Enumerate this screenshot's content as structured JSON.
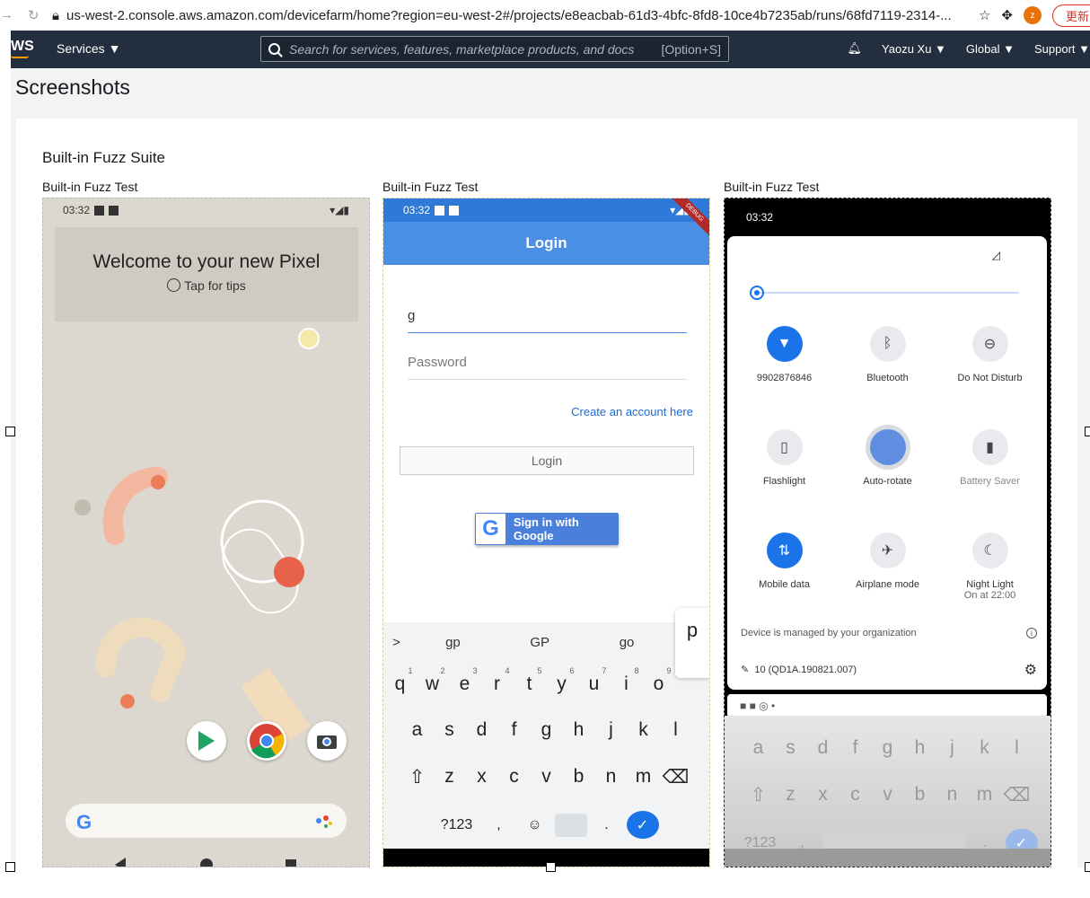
{
  "browser": {
    "url": "us-west-2.console.aws.amazon.com/devicefarm/home?region=eu-west-2#/projects/e8eacbab-61d3-4bfc-8fd8-10ce4b7235ab/runs/68fd7119-2314-...",
    "profile": "z",
    "update": "更新"
  },
  "aws": {
    "logo": "WS",
    "services": "Services ▼",
    "search_placeholder": "Search for services, features, marketplace products, and docs",
    "search_hint": "[Option+S]",
    "user": "Yaozu Xu ▼",
    "region": "Global ▼",
    "support": "Support ▼"
  },
  "page": {
    "title": "Screenshots",
    "suite": "Built-in Fuzz Suite"
  },
  "shots": [
    {
      "label": "Built-in Fuzz Test"
    },
    {
      "label": "Built-in Fuzz Test"
    },
    {
      "label": "Built-in Fuzz Test"
    }
  ],
  "phone1": {
    "time": "03:32",
    "welcome": "Welcome to your new Pixel",
    "tips": "Tap for tips",
    "google": "G"
  },
  "phone2": {
    "time": "03:32",
    "title": "Login",
    "debug": "DEBUG",
    "username": "g",
    "password": "Password",
    "create": "Create an account here",
    "login": "Login",
    "google": "Sign in with Google",
    "suggestions": [
      ">",
      "gp",
      "GP",
      "go"
    ],
    "popup": "p",
    "row1": [
      "q",
      "w",
      "e",
      "r",
      "t",
      "y",
      "u",
      "i",
      "o"
    ],
    "row1nums": [
      "1",
      "2",
      "3",
      "4",
      "5",
      "6",
      "7",
      "8",
      "9"
    ],
    "row2": [
      "a",
      "s",
      "d",
      "f",
      "g",
      "h",
      "j",
      "k",
      "l"
    ],
    "row3": [
      "⇧",
      "z",
      "x",
      "c",
      "v",
      "b",
      "n",
      "m",
      "⌫"
    ],
    "row4": [
      "?123",
      ",",
      "☺",
      ".",
      "✓"
    ]
  },
  "phone3": {
    "time": "03:32",
    "managed": "Device is managed by your organization",
    "build": "10 (QD1A.190821.007)",
    "tiles": [
      {
        "label": "9902876846",
        "icon": "wifi-icon"
      },
      {
        "label": "Bluetooth",
        "icon": "bluetooth-icon"
      },
      {
        "label": "Do Not Disturb",
        "icon": "dnd-icon"
      },
      {
        "label": "Flashlight",
        "icon": "flashlight-icon"
      },
      {
        "label": "Auto-rotate",
        "icon": "rotate-icon"
      },
      {
        "label": "Battery Saver",
        "icon": "battery-icon"
      },
      {
        "label": "Mobile data",
        "icon": "mobile-data-icon"
      },
      {
        "label": "Airplane mode",
        "icon": "airplane-icon"
      },
      {
        "label": "Night Light",
        "sub": "On at 22:00",
        "icon": "night-light-icon"
      }
    ],
    "row2": [
      "a",
      "s",
      "d",
      "f",
      "g",
      "h",
      "j",
      "k",
      "l"
    ],
    "row3": [
      "⇧",
      "z",
      "x",
      "c",
      "v",
      "b",
      "n",
      "m",
      "⌫"
    ],
    "row4": [
      "?123",
      ",",
      "."
    ]
  }
}
